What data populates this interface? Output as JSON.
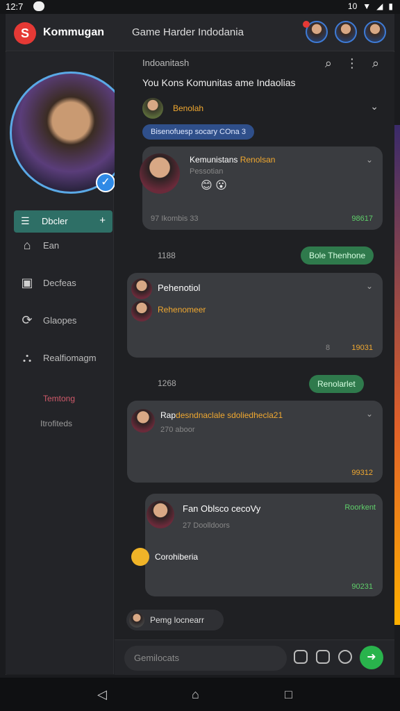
{
  "status": {
    "time": "12:7",
    "right_text": "10"
  },
  "app": {
    "brand": "Kommugan",
    "chat_title": "Game Harder Indodania"
  },
  "sidebar": {
    "selected": {
      "label": "Dbcler",
      "icon": "list-icon"
    },
    "items": [
      {
        "label": "Ean",
        "icon": "home-icon"
      },
      {
        "label": "Decfeas",
        "icon": "bag-icon"
      },
      {
        "label": "Glaopes",
        "icon": "refresh-icon"
      },
      {
        "label": "Realfiomagm",
        "icon": "person-icon"
      }
    ],
    "footer_red": "Temtong",
    "footer_grey": "Itrofiteds"
  },
  "chat": {
    "header_label": "Indoanitash",
    "channel_name": "You Kons Komunitas  ame Indaolias",
    "pinned_name": "Benolah",
    "blue_pill": "Bisenofuesp socary COna 3",
    "card1": {
      "name": "Kemunistans",
      "name_tag": "Renolsan",
      "sub": "Pessotian",
      "meta": "97 Ikombis  33",
      "reaction": "98617"
    },
    "date1": "1188",
    "pill1": "Bole Thenhone",
    "card2": {
      "name": "Pehenotiol",
      "line2": "Rehenomeer",
      "meta_icon": "8",
      "reaction": "19031"
    },
    "date2": "1268",
    "pill2": "Renolarlet",
    "card3": {
      "name": "Rap",
      "name_tag": "desndnaclale sdoliedhecla21",
      "sub": "270 aboor",
      "reaction": "99312"
    },
    "card4": {
      "name": "Fan Oblsco cecoVy",
      "badge": "Roorkent",
      "sub": "27 Doolldoors",
      "line2": "Corohiberia",
      "reaction": "90231"
    },
    "hint": "Pemg locnearr",
    "input_placeholder": "Gemilocats"
  }
}
